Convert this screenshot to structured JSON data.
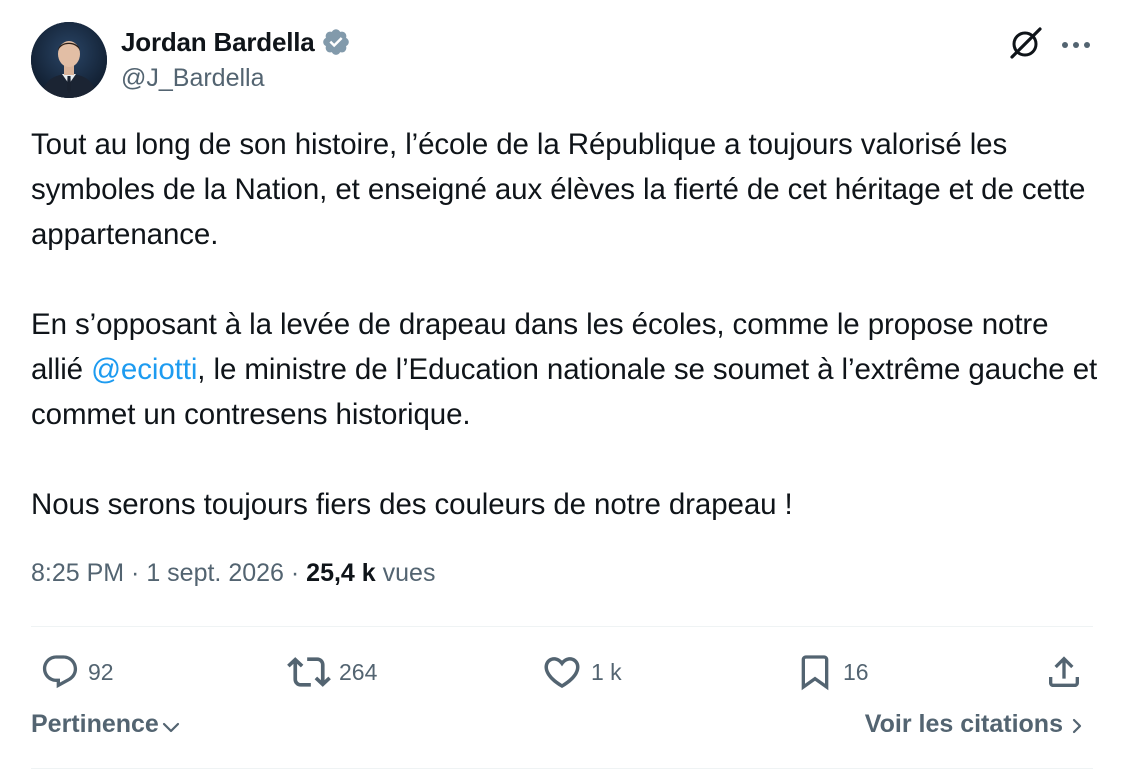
{
  "author": {
    "display_name": "Jordan Bardella",
    "handle": "@J_Bardella",
    "avatar_icon": "avatar-photo",
    "verified_badge_icon": "verified-badge-icon",
    "verified_color": "#829aab"
  },
  "header_actions": {
    "grok_icon": "grok-icon",
    "more_icon": "more-options-icon"
  },
  "tweet": {
    "paragraph1": "Tout au long de son histoire, l’école de la République a toujours valorisé les symboles de la Nation, et enseigné aux élèves la fierté de cet héritage et de cette appartenance.",
    "paragraph2_before": "En s’opposant à la levée de drapeau dans les écoles, comme le propose notre allié ",
    "paragraph2_mention": "@eciotti",
    "paragraph2_after": ", le ministre de l’Education nationale se soumet à l’extrême gauche et commet un contresens historique.",
    "paragraph3": "Nous serons toujours fiers des couleurs de notre drapeau !"
  },
  "meta": {
    "time": "8:25 PM",
    "separator": " · ",
    "date": "1 sept. 2026",
    "views_count": "25,4 k",
    "views_label": " vues"
  },
  "actions": {
    "replies": "92",
    "retweets": "264",
    "likes": "1 k",
    "bookmarks": "16"
  },
  "footer": {
    "sort_label": "Pertinence",
    "quotes_label": "Voir les citations"
  },
  "colors": {
    "text_primary": "#0f1419",
    "text_secondary": "#536471",
    "link": "#1d9bf0",
    "divider": "#eff3f4"
  }
}
